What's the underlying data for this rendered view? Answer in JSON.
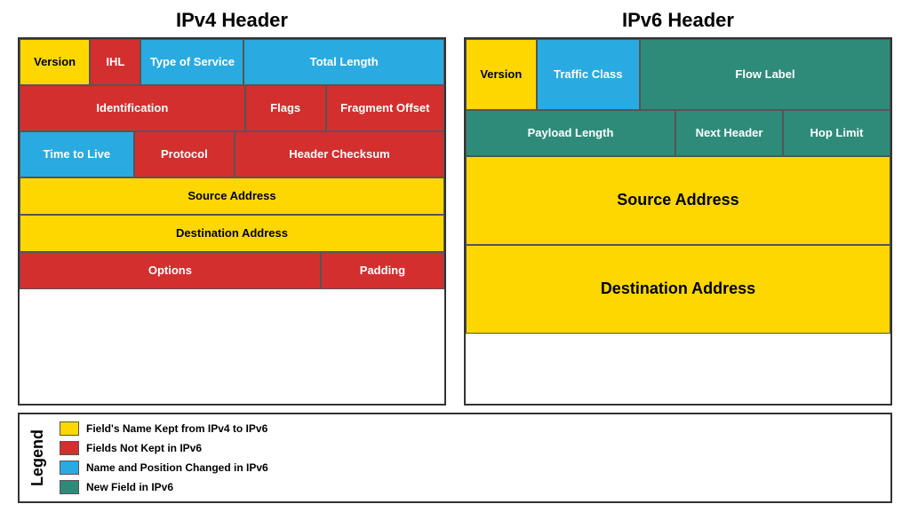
{
  "ipv4": {
    "title": "IPv4 Header",
    "rows": [
      [
        {
          "label": "Version",
          "color": "yellow",
          "flex": 1
        },
        {
          "label": "IHL",
          "color": "red",
          "flex": 0.7
        },
        {
          "label": "Type of\nService",
          "color": "blue",
          "flex": 1.5
        },
        {
          "label": "Total Length",
          "color": "blue",
          "flex": 3
        }
      ],
      [
        {
          "label": "Identification",
          "color": "red",
          "flex": 3.5
        },
        {
          "label": "Flags",
          "color": "red",
          "flex": 1.2
        },
        {
          "label": "Fragment\nOffset",
          "color": "red",
          "flex": 1.8
        }
      ],
      [
        {
          "label": "Time to Live",
          "color": "blue",
          "flex": 1.6
        },
        {
          "label": "Protocol",
          "color": "red",
          "flex": 1.4
        },
        {
          "label": "Header Checksum",
          "color": "red",
          "flex": 3
        }
      ],
      [
        {
          "label": "Source Address",
          "color": "yellow",
          "flex": 1
        }
      ],
      [
        {
          "label": "Destination Address",
          "color": "yellow",
          "flex": 1
        }
      ],
      [
        {
          "label": "Options",
          "color": "red",
          "flex": 3
        },
        {
          "label": "Padding",
          "color": "red",
          "flex": 1.2
        }
      ]
    ]
  },
  "ipv6": {
    "title": "IPv6 Header",
    "rows": [
      [
        {
          "label": "Version",
          "color": "yellow",
          "flex": 0.8
        },
        {
          "label": "Traffic\nClass",
          "color": "blue",
          "flex": 1.2
        },
        {
          "label": "Flow Label",
          "color": "teal",
          "flex": 3
        }
      ],
      [
        {
          "label": "Payload Length",
          "color": "teal",
          "flex": 3
        },
        {
          "label": "Next\nHeader",
          "color": "teal",
          "flex": 1.5
        },
        {
          "label": "Hop Limit",
          "color": "teal",
          "flex": 1.5
        }
      ],
      [
        {
          "label": "Source Address",
          "color": "yellow",
          "flex": 1,
          "large": true
        }
      ],
      [
        {
          "label": "Destination Address",
          "color": "yellow",
          "flex": 1,
          "large": true
        }
      ]
    ]
  },
  "legend": {
    "title": "Legend",
    "items": [
      {
        "color": "#FFD700",
        "label": "Field's Name Kept from IPv4 to IPv6"
      },
      {
        "color": "#D32F2F",
        "label": "Fields Not Kept in IPv6"
      },
      {
        "color": "#29ABE2",
        "label": "Name and Position Changed in IPv6"
      },
      {
        "color": "#2E8B7A",
        "label": "New Field in IPv6"
      }
    ]
  }
}
